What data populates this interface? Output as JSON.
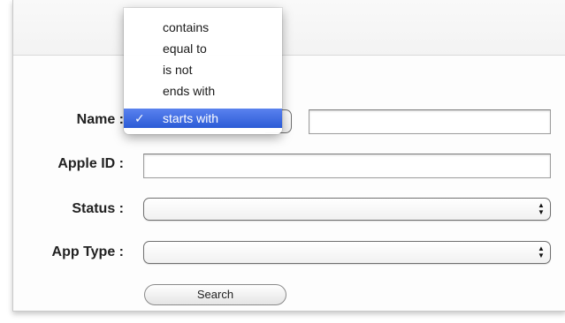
{
  "form": {
    "name_label": "Name :",
    "apple_id_label": "Apple ID :",
    "status_label": "Status :",
    "app_type_label": "App Type :",
    "name_value": "",
    "apple_id_value": "",
    "status_value": "",
    "app_type_value": "",
    "search_label": "Search"
  },
  "name_operator_menu": {
    "items": [
      "contains",
      "equal to",
      "is not",
      "ends with",
      "starts with"
    ],
    "selected": "starts with",
    "checkmark": "✓"
  },
  "icons": {
    "popup_arrows": "updown-arrows-icon",
    "checkmark": "checkmark-icon"
  },
  "colors": {
    "selection": "#2f5fd8",
    "border": "#7b7b7b"
  }
}
